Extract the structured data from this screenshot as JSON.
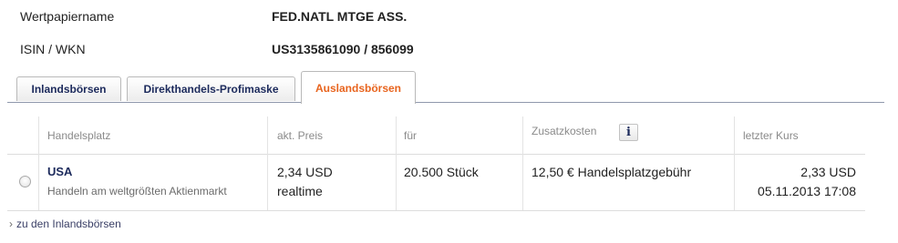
{
  "security": {
    "name_label": "Wertpapiername",
    "name_value": "FED.NATL MTGE ASS.",
    "isin_label": "ISIN / WKN",
    "isin_value": "US3135861090 / 856099"
  },
  "tabs": [
    {
      "label": "Inlandsbörsen",
      "active": false
    },
    {
      "label": "Direkthandels-Profimaske",
      "active": false
    },
    {
      "label": "Auslandsbörsen",
      "active": true
    }
  ],
  "table": {
    "headers": {
      "venue": "Handelsplatz",
      "price": "akt. Preis",
      "for": "für",
      "costs": "Zusatzkosten",
      "last": "letzter Kurs"
    },
    "info_button": "i",
    "rows": [
      {
        "venue": "USA",
        "venue_sub": "Handeln am weltgrößten Aktienmarkt",
        "price": "2,34 USD",
        "price_sub": "realtime",
        "for": "20.500 Stück",
        "costs": "12,50 € Handelsplatzgebühr",
        "last": "2,33 USD",
        "last_time": "05.11.2013 17:08"
      }
    ]
  },
  "footer_link": {
    "chevron": "›",
    "label": "zu den Inlandsbörsen"
  },
  "colors": {
    "accent_orange": "#e8641e",
    "navy": "#1c2a5c"
  }
}
